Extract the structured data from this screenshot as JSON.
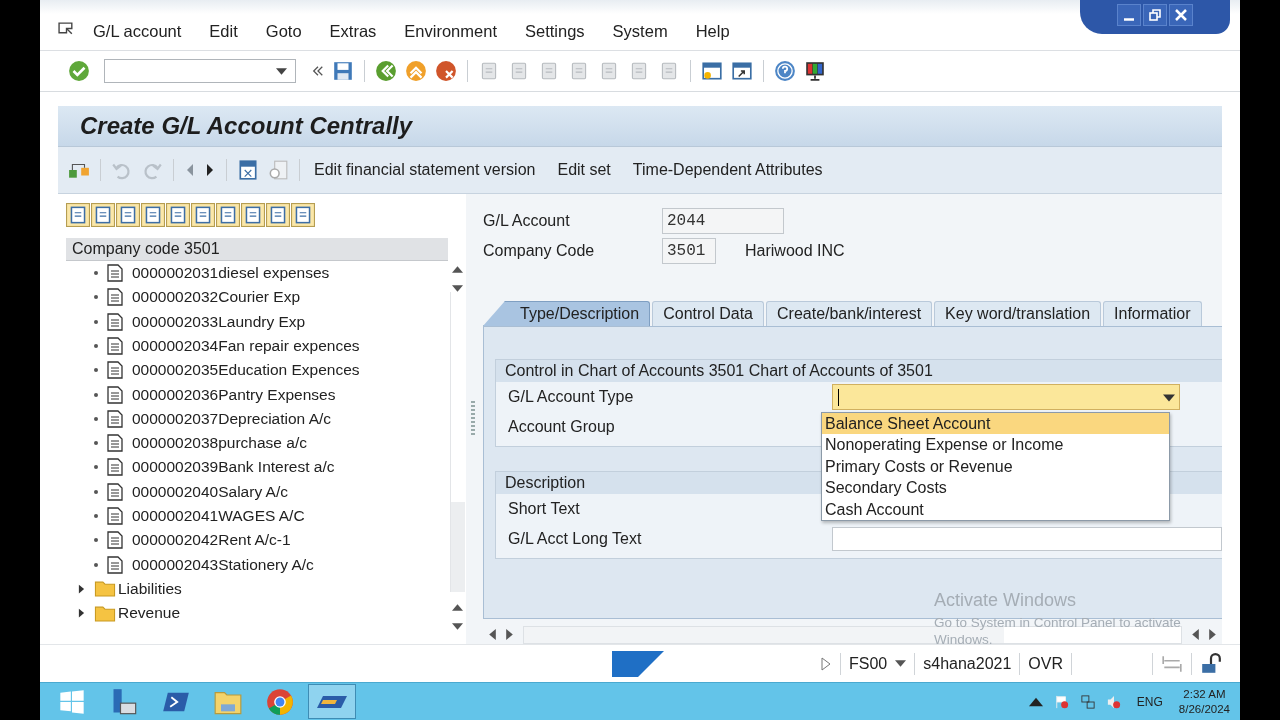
{
  "menu": [
    {
      "label": "G/L account"
    },
    {
      "label": "Edit"
    },
    {
      "label": "Goto"
    },
    {
      "label": "Extras"
    },
    {
      "label": "Environment"
    },
    {
      "label": "Settings"
    },
    {
      "label": "System"
    },
    {
      "label": "Help"
    }
  ],
  "title": "Create G/L Account Centrally",
  "app_toolbar": [
    "Edit financial statement version",
    "Edit set",
    "Time-Dependent Attributes"
  ],
  "tree": {
    "header": "Company code 3501",
    "items": [
      {
        "kind": "document",
        "label": "0000002031diesel expenses"
      },
      {
        "kind": "document",
        "label": "0000002032Courier Exp"
      },
      {
        "kind": "document",
        "label": "0000002033Laundry Exp"
      },
      {
        "kind": "document",
        "label": "0000002034Fan repair expences"
      },
      {
        "kind": "document",
        "label": "0000002035Education Expences"
      },
      {
        "kind": "document",
        "label": "0000002036Pantry Expenses"
      },
      {
        "kind": "document",
        "label": "0000002037Depreciation A/c"
      },
      {
        "kind": "document",
        "label": "0000002038purchase a/c"
      },
      {
        "kind": "document",
        "label": "0000002039Bank Interest a/c"
      },
      {
        "kind": "document",
        "label": "0000002040Salary A/c"
      },
      {
        "kind": "document",
        "label": "0000002041WAGES A/C"
      },
      {
        "kind": "document",
        "label": "0000002042Rent A/c-1"
      },
      {
        "kind": "document",
        "label": "0000002043Stationery A/c"
      },
      {
        "kind": "folder",
        "label": "Liabilities",
        "expanded": false
      },
      {
        "kind": "folder",
        "label": "Revenue",
        "expanded": false
      }
    ]
  },
  "header_fields": [
    {
      "label": "G/L Account",
      "value": "2044"
    },
    {
      "label": "Company Code",
      "value": "3501",
      "description": "Hariwood INC"
    }
  ],
  "tabs": [
    {
      "label": "Type/Description",
      "selected": true
    },
    {
      "label": "Control Data",
      "selected": false
    },
    {
      "label": "Create/bank/interest",
      "selected": false
    },
    {
      "label": "Key word/translation",
      "selected": false
    },
    {
      "label": "Informatior",
      "selected": false
    }
  ],
  "sections": [
    {
      "title": "Control in Chart of Accounts 3501 Chart of Accounts of 3501",
      "fields": [
        {
          "kind": "combo",
          "label": "G/L Account Type"
        },
        {
          "kind": "hidden",
          "label": "Account Group"
        }
      ]
    },
    {
      "title": "Description",
      "fields": [
        {
          "kind": "short",
          "label": "Short Text"
        },
        {
          "kind": "long",
          "label": "G/L Acct Long Text"
        }
      ]
    }
  ],
  "dropdown": [
    {
      "label": "Balance Sheet Account",
      "selected": true
    },
    {
      "label": "Nonoperating Expense or Income",
      "selected": false
    },
    {
      "label": "Primary Costs or Revenue",
      "selected": false
    },
    {
      "label": "Secondary Costs",
      "selected": false
    },
    {
      "label": "Cash Account",
      "selected": false
    }
  ],
  "status_bar": {
    "transaction": "FS00",
    "system": "s4hana2021",
    "mode": "OVR"
  },
  "activation_notice": [
    "Activate Windows",
    "Go to System in Control Panel to activate",
    "Windows."
  ],
  "taskbar": {
    "language": "ENG",
    "time": "2:32 AM",
    "date": "8/26/2024"
  }
}
